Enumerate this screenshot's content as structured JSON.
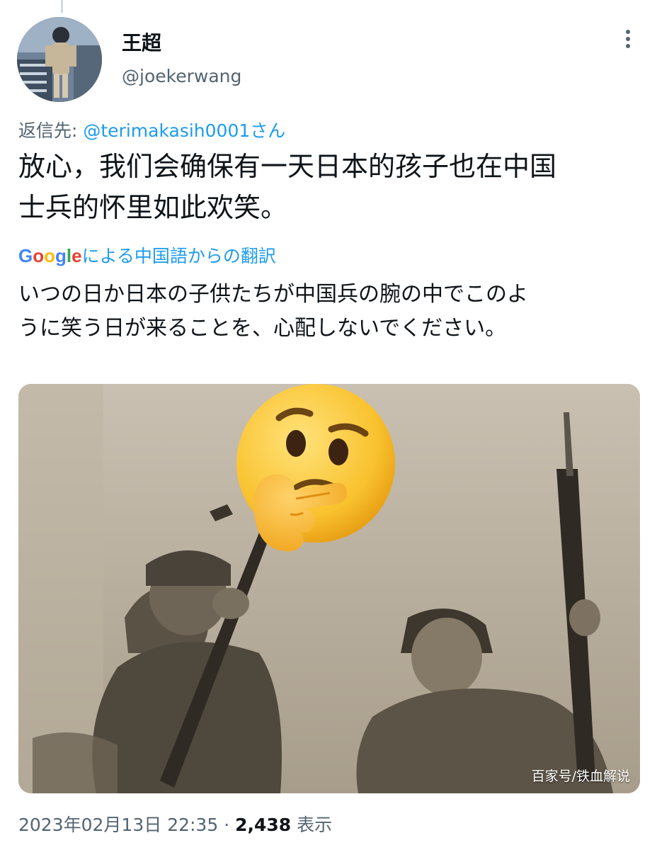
{
  "tweet": {
    "author": {
      "display_name": "王超",
      "handle": "@joekerwang"
    },
    "reply_prefix": "返信先: ",
    "reply_mention": "@terimakasih0001さん",
    "text_lines": [
      "放心，我们会确保有一天日本的孩子也在中国",
      "士兵的怀里如此欢笑。"
    ],
    "translate": {
      "provider": "Google",
      "label": "による中国語からの翻訳"
    },
    "translation_lines": [
      "いつの日か日本の子供たちが中国兵の腕の中でこのよ",
      "うに笑う日が来ることを、心配しないでください。"
    ],
    "media": {
      "watermark": "百家号/铁血解说",
      "overlay_icon": "thinking-face-emoji"
    },
    "timestamp": "2023年02月13日 22:35",
    "separator": " · ",
    "views_count": "2,438",
    "views_label": " 表示"
  },
  "colors": {
    "link_blue": "#1d9bf0",
    "secondary_text": "#536471",
    "primary_text": "#0f1419"
  }
}
